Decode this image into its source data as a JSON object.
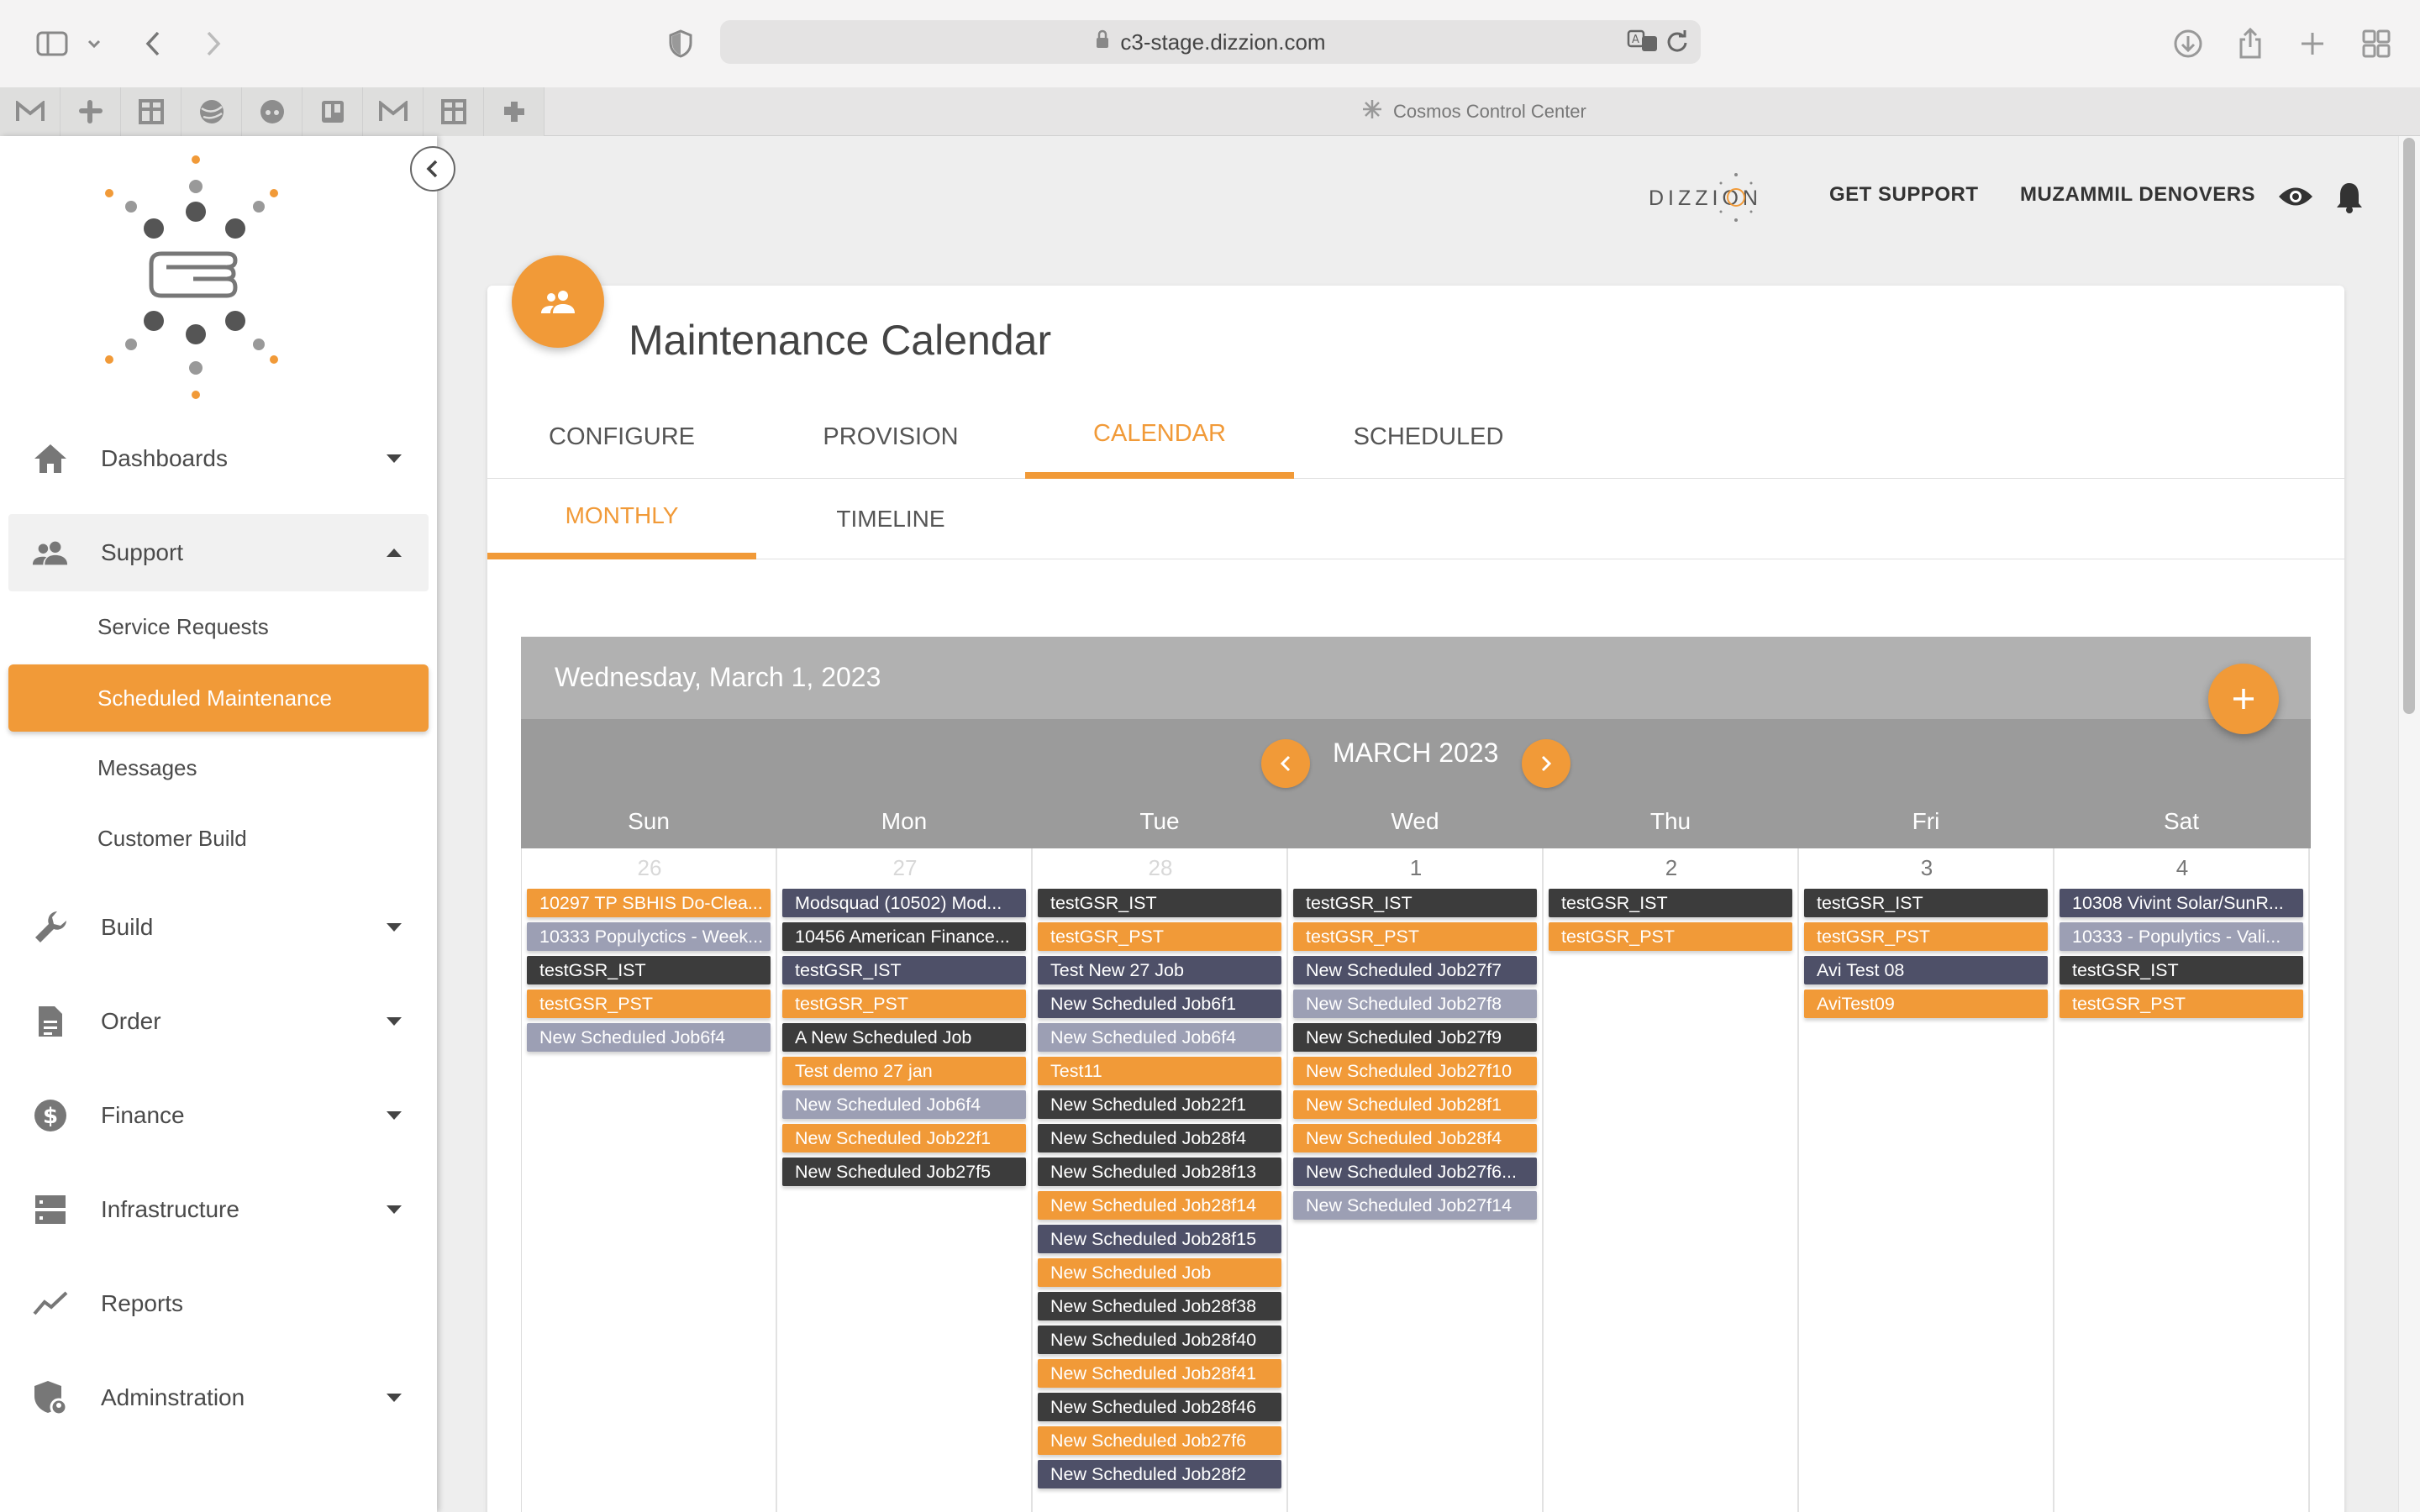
{
  "browser": {
    "url": "c3-stage.dizzion.com",
    "tab_title": "Cosmos Control Center"
  },
  "sidebar": {
    "nav": [
      {
        "label": "Dashboards",
        "icon": "home-icon",
        "state": "collapsed"
      },
      {
        "label": "Support",
        "icon": "people-icon",
        "state": "expanded"
      },
      {
        "label": "Build",
        "icon": "wrench-icon",
        "state": "collapsed"
      },
      {
        "label": "Order",
        "icon": "document-icon",
        "state": "collapsed"
      },
      {
        "label": "Finance",
        "icon": "dollar-icon",
        "state": "collapsed"
      },
      {
        "label": "Infrastructure",
        "icon": "server-icon",
        "state": "collapsed"
      },
      {
        "label": "Reports",
        "icon": "trend-icon",
        "state": "none"
      },
      {
        "label": "Adminstration",
        "icon": "shield-icon",
        "state": "collapsed"
      }
    ],
    "support_items": [
      {
        "label": "Service Requests"
      },
      {
        "label": "Scheduled Maintenance",
        "active": true
      },
      {
        "label": "Messages"
      },
      {
        "label": "Customer Build"
      }
    ]
  },
  "header": {
    "brand": "DIZZION",
    "get_support": "GET SUPPORT",
    "user": "MUZAMMIL DENOVERS"
  },
  "page": {
    "title": "Maintenance Calendar",
    "tabs": [
      {
        "label": "CONFIGURE"
      },
      {
        "label": "PROVISION"
      },
      {
        "label": "CALENDAR",
        "active": true
      },
      {
        "label": "SCHEDULED"
      }
    ],
    "subtabs": [
      {
        "label": "MONTHLY",
        "active": true
      },
      {
        "label": "TIMELINE"
      }
    ]
  },
  "calendar": {
    "selected_date": "Wednesday, March 1, 2023",
    "month": "MARCH 2023",
    "weekdays": [
      "Sun",
      "Mon",
      "Tue",
      "Wed",
      "Thu",
      "Fri",
      "Sat"
    ],
    "colors": {
      "dark": "#3c3c3c",
      "orange": "#f19a38",
      "navy": "#4e5068",
      "lavender": "#9c9fb4"
    },
    "days": [
      {
        "num": "26",
        "muted": true,
        "events": [
          {
            "text": "10297 TP SBHIS Do-Clea...",
            "c": "o"
          },
          {
            "text": "10333 Populyctics - Week...",
            "c": "l"
          },
          {
            "text": "testGSR_IST",
            "c": "d"
          },
          {
            "text": "testGSR_PST",
            "c": "o"
          },
          {
            "text": "New Scheduled Job6f4",
            "c": "l"
          }
        ]
      },
      {
        "num": "27",
        "muted": true,
        "events": [
          {
            "text": "Modsquad (10502) Mod...",
            "c": "n"
          },
          {
            "text": "10456 American Finance...",
            "c": "d"
          },
          {
            "text": "testGSR_IST",
            "c": "n"
          },
          {
            "text": "testGSR_PST",
            "c": "o"
          },
          {
            "text": "A New Scheduled Job",
            "c": "d"
          },
          {
            "text": "Test demo 27 jan",
            "c": "o"
          },
          {
            "text": "New Scheduled Job6f4",
            "c": "l"
          },
          {
            "text": "New Scheduled Job22f1",
            "c": "o"
          },
          {
            "text": "New Scheduled Job27f5",
            "c": "d"
          }
        ]
      },
      {
        "num": "28",
        "muted": true,
        "events": [
          {
            "text": "testGSR_IST",
            "c": "d"
          },
          {
            "text": "testGSR_PST",
            "c": "o"
          },
          {
            "text": "Test New 27 Job",
            "c": "n"
          },
          {
            "text": "New Scheduled Job6f1",
            "c": "n"
          },
          {
            "text": "New Scheduled Job6f4",
            "c": "l"
          },
          {
            "text": "Test11",
            "c": "o"
          },
          {
            "text": "New Scheduled Job22f1",
            "c": "d"
          },
          {
            "text": "New Scheduled Job28f4",
            "c": "d"
          },
          {
            "text": "New Scheduled Job28f13",
            "c": "d"
          },
          {
            "text": "New Scheduled Job28f14",
            "c": "o"
          },
          {
            "text": "New Scheduled Job28f15",
            "c": "n"
          },
          {
            "text": "New Scheduled Job",
            "c": "o"
          },
          {
            "text": "New Scheduled Job28f38",
            "c": "d"
          },
          {
            "text": "New Scheduled Job28f40",
            "c": "d"
          },
          {
            "text": "New Scheduled Job28f41",
            "c": "o"
          },
          {
            "text": "New Scheduled Job28f46",
            "c": "d"
          },
          {
            "text": "New Scheduled Job27f6",
            "c": "o"
          },
          {
            "text": "New Scheduled Job28f2",
            "c": "n"
          }
        ]
      },
      {
        "num": "1",
        "muted": false,
        "events": [
          {
            "text": "testGSR_IST",
            "c": "d"
          },
          {
            "text": "testGSR_PST",
            "c": "o"
          },
          {
            "text": "New Scheduled Job27f7",
            "c": "n"
          },
          {
            "text": "New Scheduled Job27f8",
            "c": "l"
          },
          {
            "text": "New Scheduled Job27f9",
            "c": "d"
          },
          {
            "text": "New Scheduled Job27f10",
            "c": "o"
          },
          {
            "text": "New Scheduled Job28f1",
            "c": "o"
          },
          {
            "text": "New Scheduled Job28f4",
            "c": "o"
          },
          {
            "text": "New Scheduled Job27f6...",
            "c": "n"
          },
          {
            "text": "New Scheduled Job27f14",
            "c": "l"
          }
        ]
      },
      {
        "num": "2",
        "muted": false,
        "events": [
          {
            "text": "testGSR_IST",
            "c": "d"
          },
          {
            "text": "testGSR_PST",
            "c": "o"
          }
        ]
      },
      {
        "num": "3",
        "muted": false,
        "events": [
          {
            "text": "testGSR_IST",
            "c": "d"
          },
          {
            "text": "testGSR_PST",
            "c": "o"
          },
          {
            "text": "Avi Test 08",
            "c": "n"
          },
          {
            "text": "AviTest09",
            "c": "o"
          }
        ]
      },
      {
        "num": "4",
        "muted": false,
        "events": [
          {
            "text": "10308 Vivint Solar/SunR...",
            "c": "n"
          },
          {
            "text": "10333 - Populytics - Vali...",
            "c": "l"
          },
          {
            "text": "testGSR_IST",
            "c": "d"
          },
          {
            "text": "testGSR_PST",
            "c": "o"
          }
        ]
      }
    ]
  }
}
